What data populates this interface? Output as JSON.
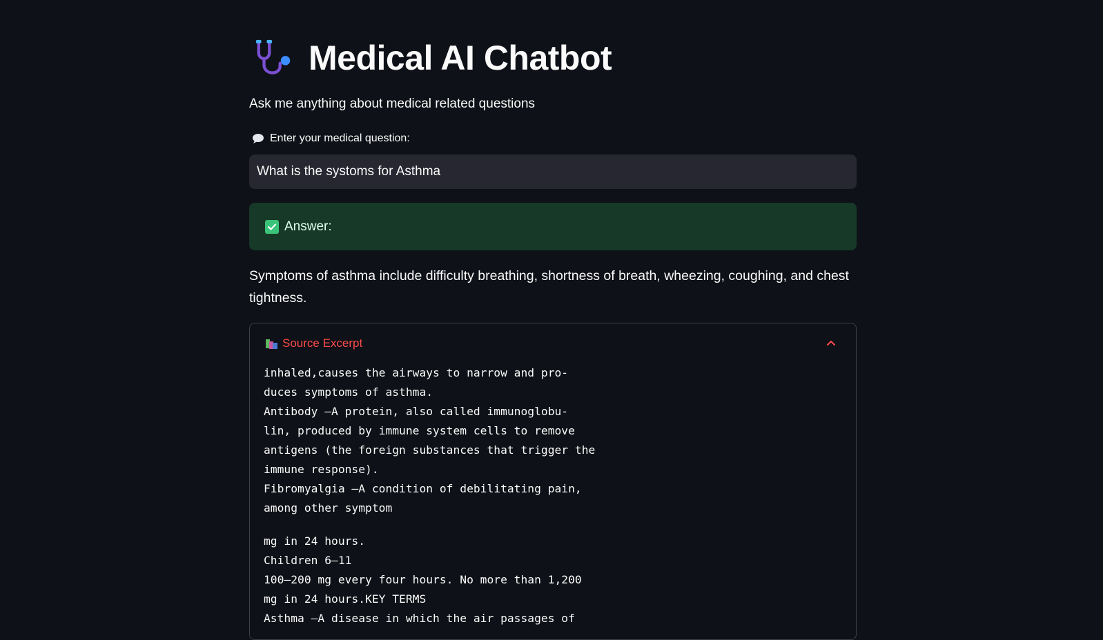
{
  "header": {
    "icon": "stethoscope-icon",
    "title": "Medical AI Chatbot",
    "subtitle": "Ask me anything about medical related questions"
  },
  "question": {
    "label_icon": "speech-balloon-icon",
    "label": "Enter your medical question:",
    "value": "What is the systoms for Asthma"
  },
  "answer": {
    "icon": "check-mark-icon",
    "heading": "Answer:",
    "text": "Symptoms of asthma include difficulty breathing, shortness of breath, wheezing, coughing, and chest tightness."
  },
  "source": {
    "icon": "books-icon",
    "title": "Source Excerpt",
    "toggle_icon": "chevron-up-icon",
    "excerpt_1": "inhaled,causes the airways to narrow and pro-\nduces symptoms of asthma.\nAntibody —A protein, also called immunoglobu-\nlin, produced by immune system cells to remove\nantigens (the foreign substances that trigger the\nimmune response).\nFibromyalgia —A condition of debilitating pain,\namong other symptom",
    "excerpt_2": "mg in 24 hours.\nChildren 6–11\n100–200 mg every four hours. No more than 1,200\nmg in 24 hours.KEY TERMS\nAsthma —A disease in which the air passages of"
  },
  "colors": {
    "background": "#0e1117",
    "input_bg": "#262730",
    "success_bg": "#173928",
    "accent": "#ff4b4b"
  }
}
